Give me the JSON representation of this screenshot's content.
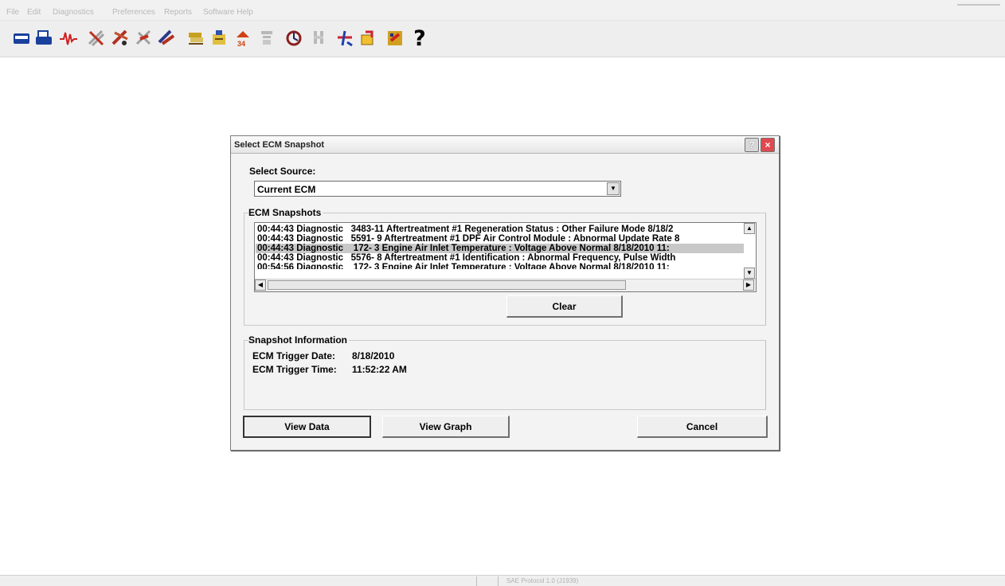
{
  "menubar": {
    "items": [
      "File",
      "Edit",
      "Diagnostics",
      "Preferences",
      "Reports",
      "Software Help"
    ]
  },
  "toolbar": {
    "tools": [
      {
        "icon": "open-folder-icon",
        "color": "#1a3f9c"
      },
      {
        "icon": "print-icon",
        "color": "#1a3f9c"
      },
      {
        "icon": "waveform-icon",
        "color": "#d02020"
      },
      {
        "icon": "diagnostic-link-icon",
        "color": "#b03020"
      },
      {
        "icon": "diagnostic-link-2-icon",
        "color": "#b03020"
      },
      {
        "icon": "diagnostic-link-3-icon",
        "color": "#b03020"
      },
      {
        "icon": "diagnostic-link-4-icon",
        "color": "#b03020"
      },
      {
        "icon": "component-test-icon",
        "color": "#c8a020"
      },
      {
        "icon": "data-monitor-icon",
        "color": "#c8a020"
      },
      {
        "icon": "parameter-icon",
        "color": "#d04010"
      },
      {
        "icon": "disabled-parameter-icon",
        "color": "#b8b8b8"
      },
      {
        "icon": "snapshot-icon",
        "color": "#8a2020"
      },
      {
        "icon": "disabled-tool-icon",
        "color": "#b8b8b8"
      },
      {
        "icon": "ecm-trigger-icon",
        "color": "#d02030"
      },
      {
        "icon": "calibration-icon",
        "color": "#d0a020"
      },
      {
        "icon": "report-icon",
        "color": "#d03020"
      }
    ],
    "help_label": "?"
  },
  "dialog": {
    "title": "Select ECM Snapshot",
    "help_button": "?",
    "close_button": "×",
    "select_source_label": "Select Source:",
    "select_source_value": "Current ECM",
    "snapshots_label": "ECM Snapshots",
    "snapshots": [
      "00:44:43 Diagnostic   3483-11 Aftertreatment #1 Regeneration Status : Other Failure Mode 8/18/2",
      "00:44:43 Diagnostic   5591- 9 Aftertreatment #1 DPF Air Control Module : Abnormal Update Rate 8",
      "00:44:43 Diagnostic    172- 3 Engine Air Inlet Temperature : Voltage Above Normal 8/18/2010 11:",
      "00:44:43 Diagnostic   5576- 8 Aftertreatment #1 Identification : Abnormal Frequency, Pulse Width",
      "00:54:56 Diagnostic    172- 3 Engine Air Inlet Temperature : Voltage Above Normal 8/18/2010 11:"
    ],
    "selected_index": 2,
    "clear_button": "Clear",
    "info_label": "Snapshot Information",
    "trigger_date_label": "ECM Trigger Date:",
    "trigger_date": "8/18/2010",
    "trigger_time_label": "ECM Trigger Time:",
    "trigger_time": "11:52:22 AM",
    "view_data_button": "View Data",
    "view_graph_button": "View Graph",
    "cancel_button": "Cancel"
  },
  "statusbar": {
    "text": "SAE Protocol 1.0 (J1939)"
  }
}
